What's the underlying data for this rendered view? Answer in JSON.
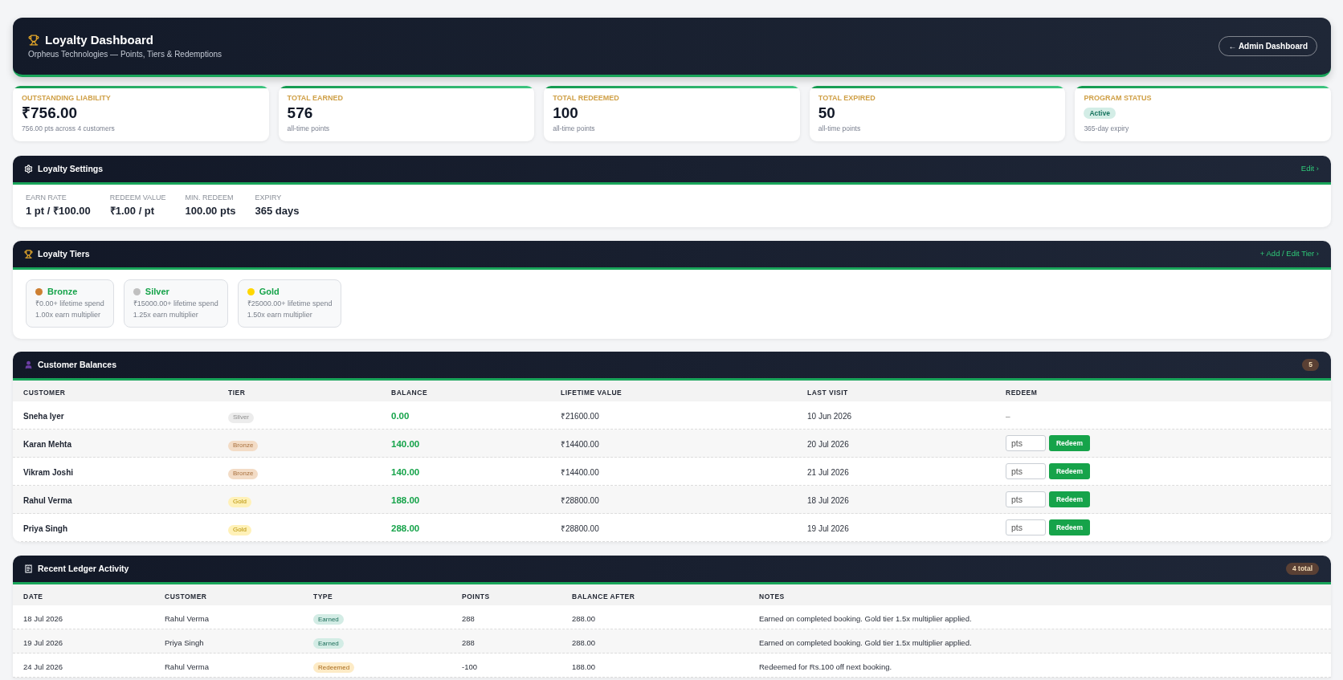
{
  "header": {
    "title": "Loyalty Dashboard",
    "subtitle": "Orpheus Technologies — Points, Tiers & Redemptions",
    "back_button": "← Admin Dashboard"
  },
  "stats": [
    {
      "kind": "value",
      "label": "OUTSTANDING LIABILITY",
      "value": "₹756.00",
      "note": "756.00 pts across 4 customers"
    },
    {
      "kind": "value",
      "label": "TOTAL EARNED",
      "value": "576",
      "note": "all-time points"
    },
    {
      "kind": "value",
      "label": "TOTAL REDEEMED",
      "value": "100",
      "note": "all-time points"
    },
    {
      "kind": "value",
      "label": "TOTAL EXPIRED",
      "value": "50",
      "note": "all-time points"
    },
    {
      "kind": "badge",
      "label": "PROGRAM STATUS",
      "badge": "Active",
      "note": "365-day expiry"
    }
  ],
  "settings": {
    "title": "Loyalty Settings",
    "action": "Edit ›",
    "items": [
      {
        "label": "EARN RATE",
        "value": "1 pt / ₹100.00"
      },
      {
        "label": "REDEEM VALUE",
        "value": "₹1.00 / pt"
      },
      {
        "label": "MIN. REDEEM",
        "value": "100.00 pts"
      },
      {
        "label": "EXPIRY",
        "value": "365 days"
      }
    ]
  },
  "tiers": {
    "title": "Loyalty Tiers",
    "action": "+ Add / Edit Tier ›",
    "items": [
      {
        "name": "Bronze",
        "color": "#cd7f32",
        "spend": "₹0.00+ lifetime spend",
        "multiplier": "1.00x earn multiplier"
      },
      {
        "name": "Silver",
        "color": "#c0c0c0",
        "spend": "₹15000.00+ lifetime spend",
        "multiplier": "1.25x earn multiplier"
      },
      {
        "name": "Gold",
        "color": "#ffd700",
        "spend": "₹25000.00+ lifetime spend",
        "multiplier": "1.50x earn multiplier"
      }
    ]
  },
  "customers": {
    "title": "Customer Balances",
    "count": "5",
    "columns": [
      "CUSTOMER",
      "TIER",
      "BALANCE",
      "LIFETIME VALUE",
      "LAST VISIT",
      "REDEEM"
    ],
    "rows": [
      {
        "customer": "Sneha Iyer",
        "tier": {
          "label": "Silver",
          "kind": "silver"
        },
        "balance": "0.00",
        "lifetime_value": "₹21600.00",
        "last_visit": "10 Jun 2026",
        "redeem": {
          "kind": "none",
          "text": "–"
        }
      },
      {
        "customer": "Karan Mehta",
        "tier": {
          "label": "Bronze",
          "kind": "bronze"
        },
        "balance": "140.00",
        "lifetime_value": "₹14400.00",
        "last_visit": "20 Jul 2026",
        "redeem": {
          "kind": "form",
          "placeholder": "pts",
          "button": "Redeem"
        }
      },
      {
        "customer": "Vikram Joshi",
        "tier": {
          "label": "Bronze",
          "kind": "bronze"
        },
        "balance": "140.00",
        "lifetime_value": "₹14400.00",
        "last_visit": "21 Jul 2026",
        "redeem": {
          "kind": "form",
          "placeholder": "pts",
          "button": "Redeem"
        }
      },
      {
        "customer": "Rahul Verma",
        "tier": {
          "label": "Gold",
          "kind": "gold"
        },
        "balance": "188.00",
        "lifetime_value": "₹28800.00",
        "last_visit": "18 Jul 2026",
        "redeem": {
          "kind": "form",
          "placeholder": "pts",
          "button": "Redeem"
        }
      },
      {
        "customer": "Priya Singh",
        "tier": {
          "label": "Gold",
          "kind": "gold"
        },
        "balance": "288.00",
        "lifetime_value": "₹28800.00",
        "last_visit": "19 Jul 2026",
        "redeem": {
          "kind": "form",
          "placeholder": "pts",
          "button": "Redeem"
        }
      }
    ]
  },
  "ledger": {
    "title": "Recent Ledger Activity",
    "count": "4 total",
    "columns": [
      "DATE",
      "CUSTOMER",
      "TYPE",
      "POINTS",
      "BALANCE AFTER",
      "NOTES"
    ],
    "rows": [
      {
        "date": "18 Jul 2026",
        "customer": "Rahul Verma",
        "type": {
          "label": "Earned",
          "kind": "earned"
        },
        "points": "288",
        "balance_after": "288.00",
        "notes": "Earned on completed booking. Gold tier 1.5x multiplier applied."
      },
      {
        "date": "19 Jul 2026",
        "customer": "Priya Singh",
        "type": {
          "label": "Earned",
          "kind": "earned"
        },
        "points": "288",
        "balance_after": "288.00",
        "notes": "Earned on completed booking. Gold tier 1.5x multiplier applied."
      },
      {
        "date": "24 Jul 2026",
        "customer": "Rahul Verma",
        "type": {
          "label": "Redeemed",
          "kind": "redeemed"
        },
        "points": "-100",
        "balance_after": "188.00",
        "notes": "Redeemed for Rs.100 off next booking."
      }
    ]
  }
}
